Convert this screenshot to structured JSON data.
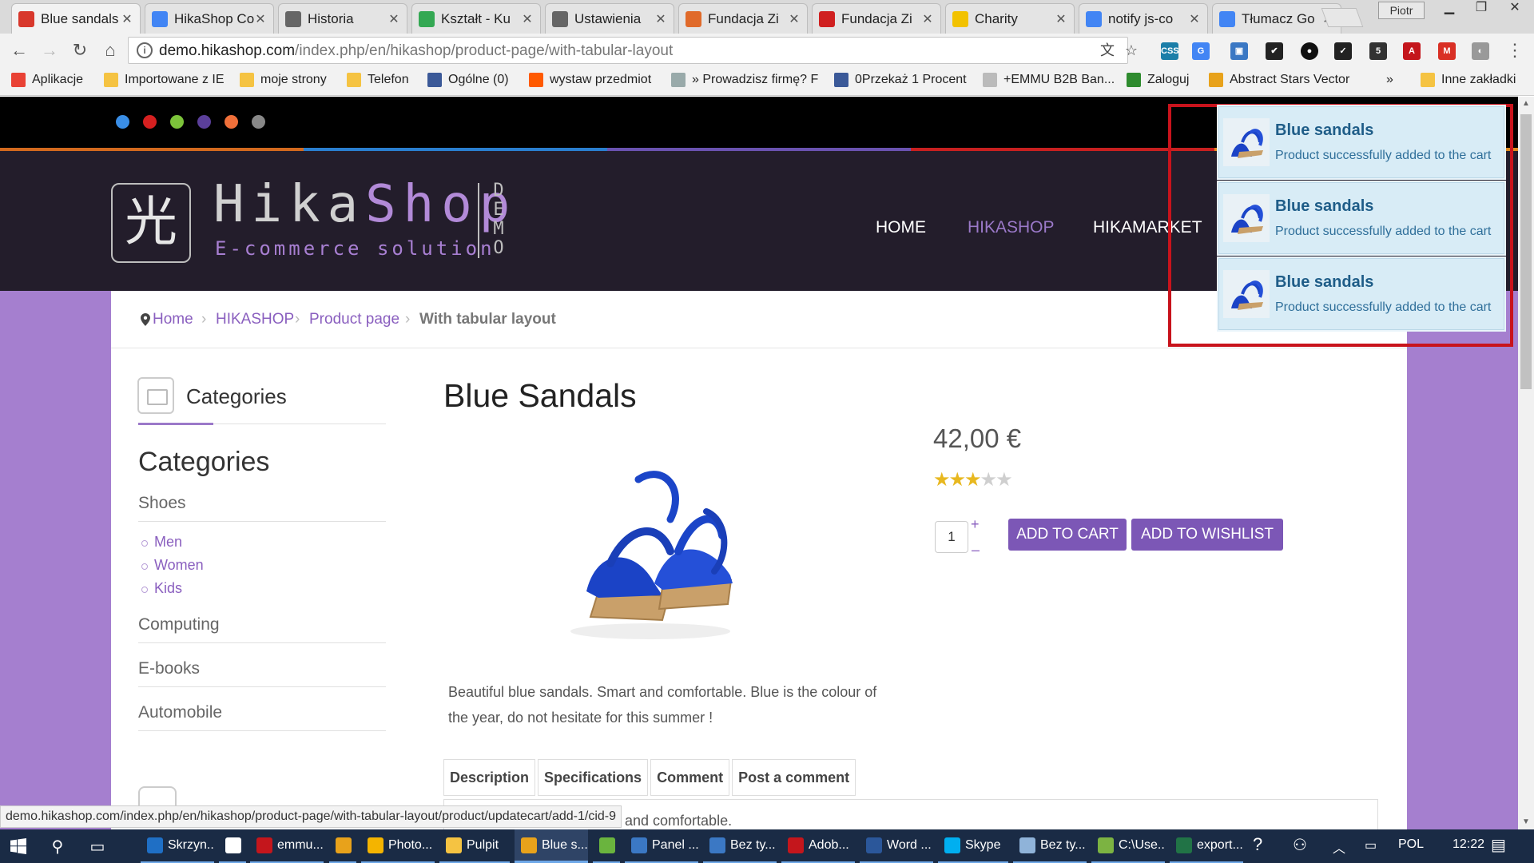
{
  "browser": {
    "tabs": [
      {
        "title": "Blue sandals",
        "icon": "joomla-icon",
        "color": "#d8382c",
        "active": true
      },
      {
        "title": "HikaShop Co",
        "icon": "google-icon",
        "color": "#4285f4",
        "active": false
      },
      {
        "title": "Historia",
        "icon": "history-icon",
        "color": "#666666",
        "active": false
      },
      {
        "title": "Kształt - Ku",
        "icon": "google-shapes-icon",
        "color": "#34a853",
        "active": false
      },
      {
        "title": "Ustawienia",
        "icon": "gear-icon",
        "color": "#666666",
        "active": false
      },
      {
        "title": "Fundacja Zi",
        "icon": "foundation-icon",
        "color": "#e06a2a",
        "active": false
      },
      {
        "title": "Fundacja Zi",
        "icon": "heart-icon",
        "color": "#d02020",
        "active": false
      },
      {
        "title": "Charity",
        "icon": "tz-icon",
        "color": "#f2c200",
        "active": false
      },
      {
        "title": "notify js-co",
        "icon": "google-icon",
        "color": "#4285f4",
        "active": false
      },
      {
        "title": "Tłumacz Go",
        "icon": "translate-icon",
        "color": "#4285f4",
        "active": false
      }
    ],
    "user_label": "Piotr",
    "url_domain": "demo.hikashop.com",
    "url_path": "/index.php/en/hikashop/product-page/with-tabular-layout",
    "bookmarks": [
      {
        "label": "Aplikacje",
        "icon": "apps-grid-icon"
      },
      {
        "label": "Importowane z IE",
        "icon": "folder-icon"
      },
      {
        "label": "moje strony",
        "icon": "folder-icon"
      },
      {
        "label": "Telefon",
        "icon": "folder-icon"
      },
      {
        "label": "Ogólne (0)",
        "icon": "facebook-icon"
      },
      {
        "label": "wystaw przedmiot",
        "icon": "allegro-icon"
      },
      {
        "label": "» Prowadzisz firmę? F",
        "icon": "globe-icon"
      },
      {
        "label": "0Przekaż 1 Procent",
        "icon": "facebook-icon"
      },
      {
        "label": "+EMMU B2B Ban...",
        "icon": "page-icon"
      },
      {
        "label": "Zaloguj",
        "icon": "login-icon"
      },
      {
        "label": "Abstract Stars Vector",
        "icon": "vl-icon"
      }
    ],
    "bookmarks_overflow": "»",
    "other_bookmarks": "Inne zakładki",
    "status_url": "demo.hikashop.com/index.php/en/hikashop/product-page/with-tabular-layout/product/updatecart/add-1/cid-9"
  },
  "site": {
    "dot_colors": [
      "#3a8ee6",
      "#d52020",
      "#7cc33a",
      "#5b3f9a",
      "#f0703a",
      "#888888"
    ],
    "logo_mark": "光",
    "logo_word_1": "Hika",
    "logo_word_2": "Shop",
    "logo_tagline": "E-commerce solution",
    "logo_demo": "DEMO",
    "menu": [
      {
        "label": "HOME",
        "current": false
      },
      {
        "label": "HIKASHOP",
        "current": true
      },
      {
        "label": "HIKAMARKET",
        "current": false
      }
    ],
    "breadcrumb": [
      {
        "label": "Home"
      },
      {
        "label": "HIKASHOP"
      },
      {
        "label": "Product page"
      },
      {
        "label": "With tabular layout"
      }
    ],
    "sidebar": {
      "module_title": "Categories",
      "title": "Categories",
      "categories": [
        {
          "label": "Shoes",
          "children": [
            "Men",
            "Women",
            "Kids"
          ]
        },
        {
          "label": "Computing",
          "children": []
        },
        {
          "label": "E-books",
          "children": []
        },
        {
          "label": "Automobile",
          "children": []
        }
      ]
    },
    "product": {
      "name": "Blue Sandals",
      "price": "42,00 €",
      "rating": 3,
      "rating_max": 5,
      "quantity": "1",
      "qty_plus": "+",
      "qty_minus": "–",
      "add_to_cart": "ADD TO CART",
      "add_to_wishlist": "ADD TO WISHLIST",
      "description": "Beautiful blue sandals. Smart and comfortable. Blue is the colour of the year, do not hesitate for this summer !",
      "tabs": [
        "Description",
        "Specifications",
        "Comment",
        "Post a comment"
      ],
      "tab_panel_visible_text": "and comfortable."
    },
    "notifications": [
      {
        "title": "Blue sandals",
        "message": "Product successfully added to the cart"
      },
      {
        "title": "Blue sandals",
        "message": "Product successfully added to the cart"
      },
      {
        "title": "Blue sandals",
        "message": "Product successfully added to the cart"
      }
    ]
  },
  "taskbar": {
    "items": [
      {
        "label": "Skrzyn...",
        "icon": "outlook-icon",
        "color": "#1f6fc5"
      },
      {
        "label": "",
        "icon": "store-icon",
        "color": "#ffffff"
      },
      {
        "label": "emmu...",
        "icon": "filezilla-icon",
        "color": "#c4161c"
      },
      {
        "label": "",
        "icon": "chrome-icon",
        "color": "#e8a21b"
      },
      {
        "label": "Photo...",
        "icon": "photo-icon",
        "color": "#f4b400"
      },
      {
        "label": "Pulpit",
        "icon": "folder-icon",
        "color": "#f5c342"
      },
      {
        "label": "Blue s...",
        "icon": "chrome-icon",
        "color": "#e8a21b"
      },
      {
        "label": "",
        "icon": "leaf-icon",
        "color": "#6ab43e"
      },
      {
        "label": "Panel ...",
        "icon": "control-panel-icon",
        "color": "#3b78c4"
      },
      {
        "label": "Bez ty...",
        "icon": "paint-icon",
        "color": "#3b78c4"
      },
      {
        "label": "Adob...",
        "icon": "acrobat-icon",
        "color": "#c4161c"
      },
      {
        "label": "Word ...",
        "icon": "word-icon",
        "color": "#2b579a"
      },
      {
        "label": "Skype",
        "icon": "skype-icon",
        "color": "#00aff0"
      },
      {
        "label": "Bez ty...",
        "icon": "notepad-icon",
        "color": "#8fb3d9"
      },
      {
        "label": "C:\\Use...",
        "icon": "notepadpp-icon",
        "color": "#7cb342"
      },
      {
        "label": "export...",
        "icon": "excel-icon",
        "color": "#217346"
      }
    ],
    "language": "POL",
    "clock": "12:22"
  }
}
